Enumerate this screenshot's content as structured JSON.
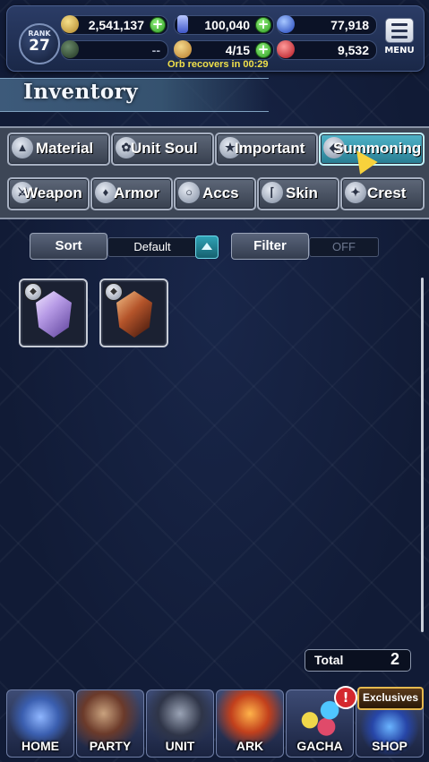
{
  "player": {
    "rank_label": "RANK",
    "rank": "27"
  },
  "currencies": {
    "gil": "2,541,137",
    "crystals": "100,040",
    "orbs_blue": "77,918",
    "ap": "--",
    "stamina": "4/15",
    "orbs_red": "9,532"
  },
  "orb_recovery_text": "Orb recovers in 00:29",
  "menu_label": "MENU",
  "page_title": "Inventory",
  "categories_row1": [
    {
      "label": "Material",
      "icon": "bag-icon"
    },
    {
      "label": "Unit Soul",
      "icon": "flame-icon"
    },
    {
      "label": "Important",
      "icon": "star-icon"
    },
    {
      "label": "Summoning",
      "icon": "summon-crystal-icon",
      "active": true
    }
  ],
  "categories_row2": [
    {
      "label": "Weapon",
      "icon": "sword-icon"
    },
    {
      "label": "Armor",
      "icon": "armor-icon"
    },
    {
      "label": "Accs",
      "icon": "ring-icon"
    },
    {
      "label": "Skin",
      "icon": "hanger-icon"
    },
    {
      "label": "Crest",
      "icon": "crest-icon"
    }
  ],
  "sort": {
    "label": "Sort",
    "value": "Default"
  },
  "filter": {
    "label": "Filter",
    "value": "OFF"
  },
  "items": [
    {
      "name": "purple-summon-crystal",
      "color": "#b79be6"
    },
    {
      "name": "red-summon-crystal",
      "color": "#b4542a"
    }
  ],
  "total": {
    "label": "Total",
    "value": "2"
  },
  "nav": {
    "home": "HOME",
    "party": "PARTY",
    "unit": "UNIT",
    "ark": "ARK",
    "gacha": "GACHA",
    "shop": "SHOP",
    "exclusives": "Exclusives",
    "gacha_alert": "!"
  },
  "colors": {
    "accent_active": "#4fb3c8",
    "plus_green": "#2e9b24",
    "timer_yellow": "#f0e04a"
  }
}
